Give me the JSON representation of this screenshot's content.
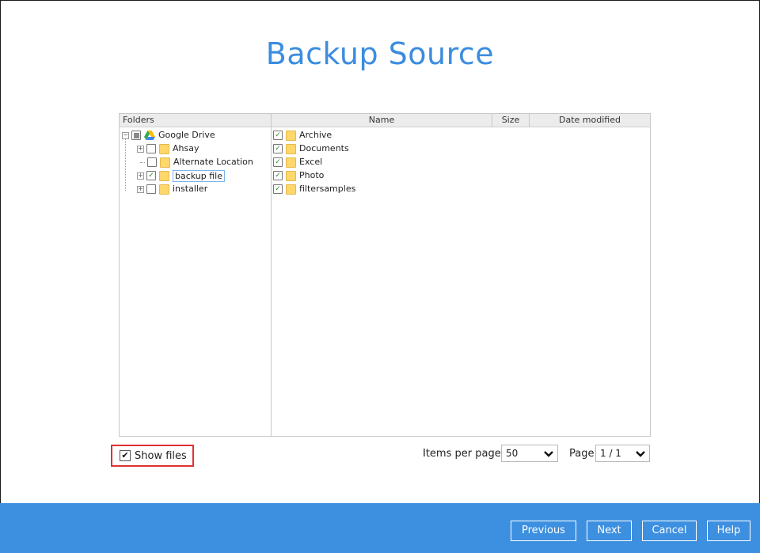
{
  "title": "Backup Source",
  "tree": {
    "header": "Folders",
    "root": {
      "label": "Google Drive",
      "icon": "google-drive-icon"
    },
    "items": [
      {
        "label": "Ahsay",
        "checked": false,
        "expandable": true
      },
      {
        "label": "Alternate Location",
        "checked": false,
        "expandable": false
      },
      {
        "label": "backup file",
        "checked": true,
        "expandable": true,
        "selected": true
      },
      {
        "label": "installer",
        "checked": false,
        "expandable": true
      }
    ]
  },
  "list": {
    "columns": [
      "Name",
      "Size",
      "Date modified"
    ],
    "rows": [
      {
        "name": "Archive",
        "checked": true
      },
      {
        "name": "Documents",
        "checked": true
      },
      {
        "name": "Excel",
        "checked": true
      },
      {
        "name": "Photo",
        "checked": true
      },
      {
        "name": "filtersamples",
        "checked": true
      }
    ]
  },
  "controls": {
    "show_files_label": "Show files",
    "show_files_checked": true,
    "items_per_page_label": "Items per page",
    "items_per_page_value": "50",
    "page_label": "Page",
    "page_value": "1 / 1"
  },
  "footer": {
    "previous": "Previous",
    "next": "Next",
    "cancel": "Cancel",
    "help": "Help"
  },
  "colors": {
    "accent": "#3d8fe0",
    "title": "#3b8ddf",
    "highlight": "#e03131",
    "check": "#2e8b2e"
  }
}
